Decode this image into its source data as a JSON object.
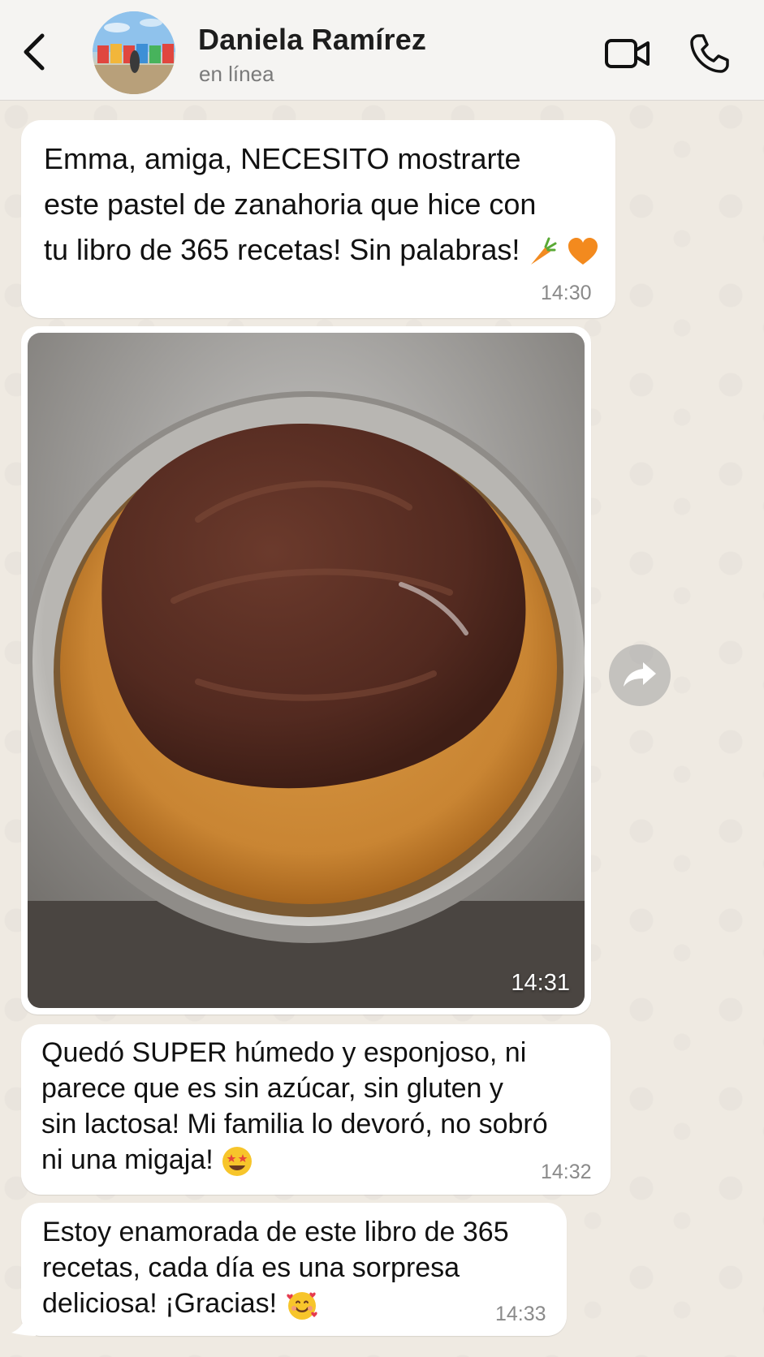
{
  "header": {
    "contact_name": "Daniela Ramírez",
    "status": "en línea"
  },
  "messages": [
    {
      "lines": [
        "Emma, amiga, NECESITO mostrarte",
        "este pastel de zanahoria que hice con",
        "tu libro de 365 recetas! Sin palabras!"
      ],
      "emojis": [
        "carrot",
        "orange-heart"
      ],
      "time": "14:30"
    },
    {
      "type": "image",
      "image_description": "Pastel de zanahoria en molde con cobertura de chocolate",
      "time": "14:31"
    },
    {
      "lines": [
        "Quedó SUPER húmedo y esponjoso, ni",
        "parece que es sin azúcar, sin gluten y",
        "sin lactosa! Mi familia lo devoró, no sobró",
        "ni una migaja!"
      ],
      "emojis": [
        "star-struck-face"
      ],
      "time": "14:32"
    },
    {
      "lines": [
        "Estoy enamorada de este libro de 365",
        "recetas, cada día es una sorpresa",
        "deliciosa! ¡Gracias!"
      ],
      "emojis": [
        "smiling-face-with-hearts"
      ],
      "time": "14:33"
    }
  ],
  "icons": {
    "back": "chevron-left-icon",
    "video": "video-camera-icon",
    "call": "phone-icon",
    "forward": "forward-arrow-icon"
  },
  "colors": {
    "background": "#efeae2",
    "header": "#f5f4f2",
    "bubble": "#ffffff",
    "text": "#111111",
    "timestamp": "#8a8a8a"
  }
}
